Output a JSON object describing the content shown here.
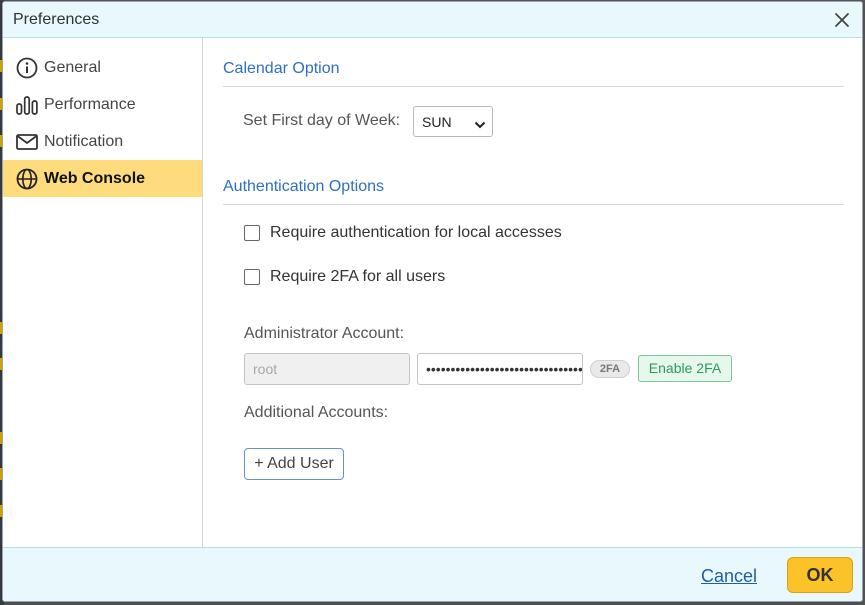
{
  "dialog": {
    "title": "Preferences"
  },
  "sidebar": {
    "items": [
      {
        "label": "General",
        "icon": "info-icon",
        "active": false
      },
      {
        "label": "Performance",
        "icon": "bar-chart-icon",
        "active": false
      },
      {
        "label": "Notification",
        "icon": "envelope-icon",
        "active": false
      },
      {
        "label": "Web Console",
        "icon": "globe-icon",
        "active": true
      }
    ]
  },
  "calendar": {
    "section_title": "Calendar Option",
    "first_day_label": "Set First day of Week:",
    "first_day_value": "SUN"
  },
  "auth": {
    "section_title": "Authentication Options",
    "local_access_label": "Require authentication for local accesses",
    "local_access_checked": false,
    "twofa_all_label": "Require 2FA for all users",
    "twofa_all_checked": false,
    "admin_label": "Administrator Account:",
    "admin_username": "root",
    "admin_password": "••••••••••••••••••••••••••••••••",
    "twofa_badge": "2FA",
    "enable_2fa_label": "Enable 2FA",
    "additional_label": "Additional Accounts:",
    "add_user_label": "+ Add User"
  },
  "footer": {
    "cancel_label": "Cancel",
    "ok_label": "OK"
  },
  "colors": {
    "accent_blue": "#2f6fc4",
    "active_item": "#fedc7d",
    "ok_button": "#fcc22a",
    "header_bg": "#e8f8fc",
    "enable_2fa_green": "#2f9a5a"
  }
}
